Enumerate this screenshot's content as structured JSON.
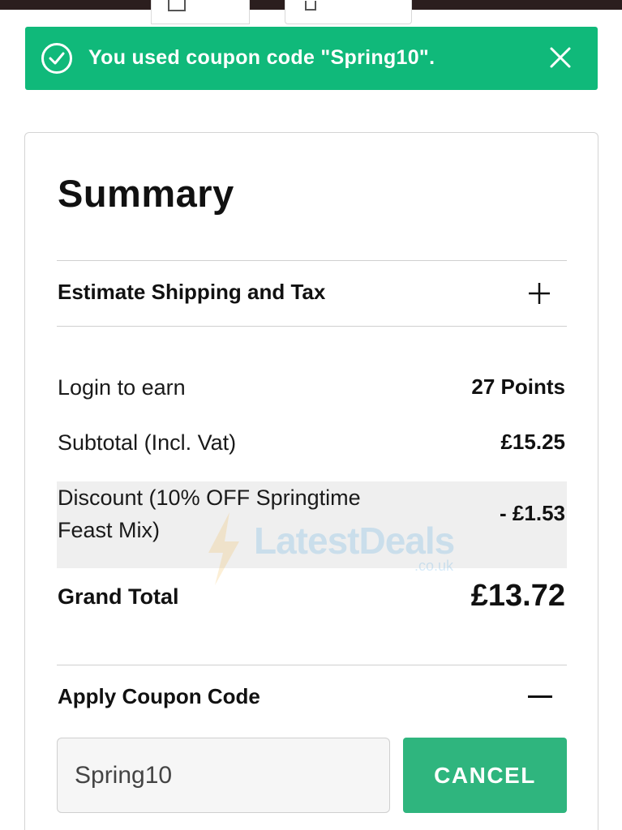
{
  "alert": {
    "message": "You used coupon code \"Spring10\"."
  },
  "summary": {
    "title": "Summary",
    "estimate_label": "Estimate Shipping and Tax",
    "lines": {
      "login_label": "Login to earn",
      "login_value": "27 Points",
      "subtotal_label": "Subtotal (Incl. Vat)",
      "subtotal_value": "£15.25",
      "discount_label_line1": "Discount (10% OFF Springtime",
      "discount_label_line2": "Feast Mix)",
      "discount_value": "- £1.53"
    },
    "grand_total_label": "Grand Total",
    "grand_total_value": "£13.72",
    "coupon": {
      "heading": "Apply Coupon Code",
      "value": "Spring10",
      "cancel_label": "CANCEL"
    }
  },
  "watermark": {
    "brand": "LatestDeals",
    "domain": ".co.uk"
  },
  "colors": {
    "alert_bg": "#10b97a",
    "cancel_bg": "#2fb57e",
    "discount_row_bg": "#efefef"
  }
}
